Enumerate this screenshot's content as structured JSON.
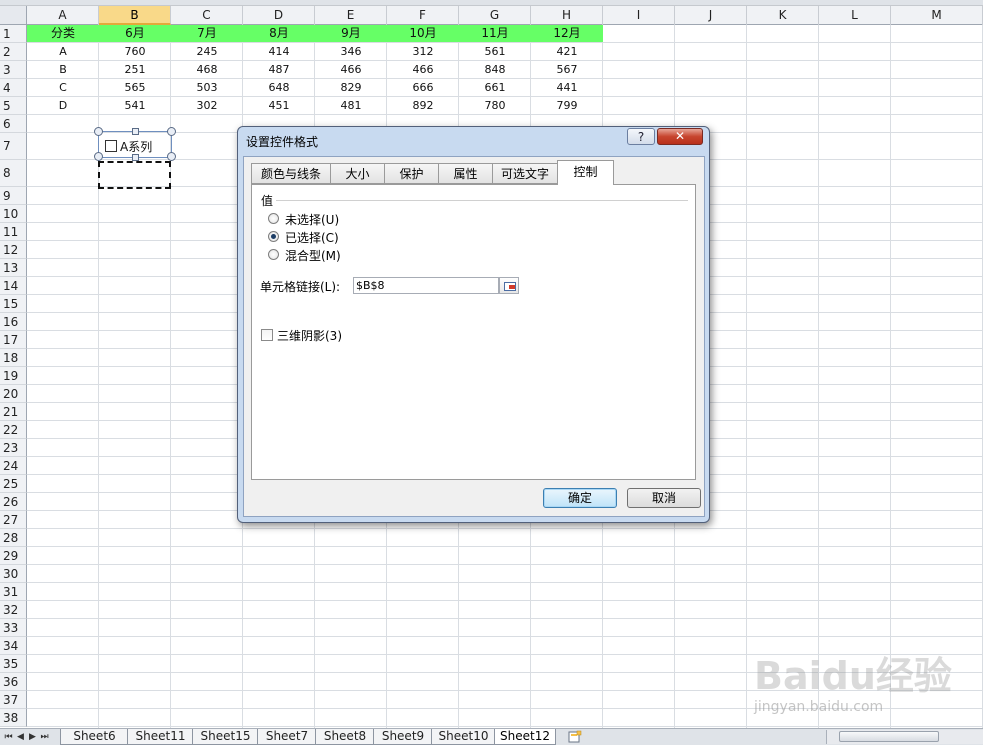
{
  "columns": [
    "A",
    "B",
    "C",
    "D",
    "E",
    "F",
    "G",
    "H",
    "I",
    "J",
    "K",
    "L",
    "M"
  ],
  "selected_column": "B",
  "rows": [
    "1",
    "2",
    "3",
    "4",
    "5",
    "6",
    "7",
    "8",
    "9",
    "10",
    "11",
    "12",
    "13",
    "14",
    "15",
    "16",
    "17",
    "18",
    "19",
    "20",
    "21",
    "22",
    "23",
    "24",
    "25",
    "26",
    "27",
    "28",
    "29",
    "30",
    "31",
    "32",
    "33",
    "34",
    "35",
    "36",
    "37",
    "38"
  ],
  "table": {
    "headers": [
      "分类",
      "6月",
      "7月",
      "8月",
      "9月",
      "10月",
      "11月",
      "12月"
    ],
    "rows": [
      [
        "A",
        "760",
        "245",
        "414",
        "346",
        "312",
        "561",
        "421"
      ],
      [
        "B",
        "251",
        "468",
        "487",
        "466",
        "466",
        "848",
        "567"
      ],
      [
        "C",
        "565",
        "503",
        "648",
        "829",
        "666",
        "661",
        "441"
      ],
      [
        "D",
        "541",
        "302",
        "451",
        "481",
        "892",
        "780",
        "799"
      ]
    ]
  },
  "checkbox_control": {
    "label": "A系列"
  },
  "dialog": {
    "title": "设置控件格式",
    "help_label": "?",
    "close_label": "✕",
    "tabs": [
      "颜色与线条",
      "大小",
      "保护",
      "属性",
      "可选文字",
      "控制"
    ],
    "active_tab": "控制",
    "value_group_label": "值",
    "radio_options": [
      "未选择(U)",
      "已选择(C)",
      "混合型(M)"
    ],
    "selected_radio": "已选择(C)",
    "cell_link_label": "单元格链接(L):",
    "cell_link_value": "$B$8",
    "shading_label": "三维阴影(3)",
    "shading_checked": false,
    "ok_label": "确定",
    "cancel_label": "取消"
  },
  "sheet_tabs": [
    "Sheet6",
    "Sheet11",
    "Sheet15",
    "Sheet7",
    "Sheet8",
    "Sheet9",
    "Sheet10",
    "Sheet12"
  ],
  "active_sheet": "Sheet12",
  "watermark": {
    "brand": "Baidu经验",
    "url": "jingyan.baidu.com"
  },
  "colors": {
    "header_fill": "#66ff66",
    "selected_col": "#f9d989"
  }
}
